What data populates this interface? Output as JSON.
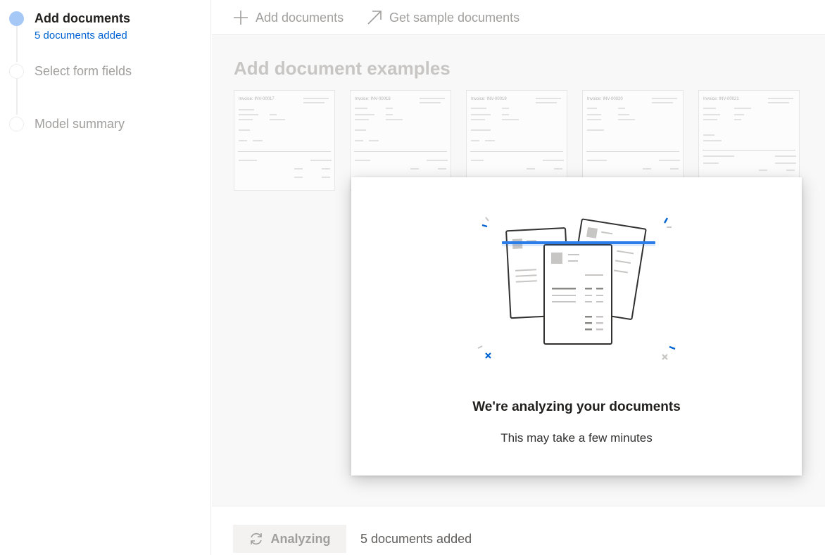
{
  "stepper": {
    "steps": [
      {
        "label": "Add documents",
        "sublabel": "5 documents added",
        "state": "active"
      },
      {
        "label": "Select form fields",
        "state": "pending"
      },
      {
        "label": "Model summary",
        "state": "pending"
      }
    ]
  },
  "toolbar": {
    "add_label": "Add documents",
    "add_icon": "plus-icon",
    "sample_label": "Get sample documents",
    "sample_icon": "arrow-up-right-icon"
  },
  "content": {
    "title": "Add document examples",
    "documents": [
      {
        "label": "Invoice: INV-00017"
      },
      {
        "label": "Invoice: INV-00018"
      },
      {
        "label": "Invoice: INV-00019"
      },
      {
        "label": "Invoice: INV-00020"
      },
      {
        "label": "Invoice: INV-00021"
      }
    ]
  },
  "modal": {
    "title": "We're analyzing your documents",
    "subtitle": "This may take a few minutes",
    "illustration": "scanning-documents-illustration"
  },
  "footer": {
    "button_label": "Analyzing",
    "button_icon": "sync-icon",
    "status": "5 documents added"
  },
  "colors": {
    "accent": "#0063d3",
    "active_step": "#a6c8f7",
    "scan_line": "#2b7de9",
    "disabled_text": "#a19f9d"
  }
}
